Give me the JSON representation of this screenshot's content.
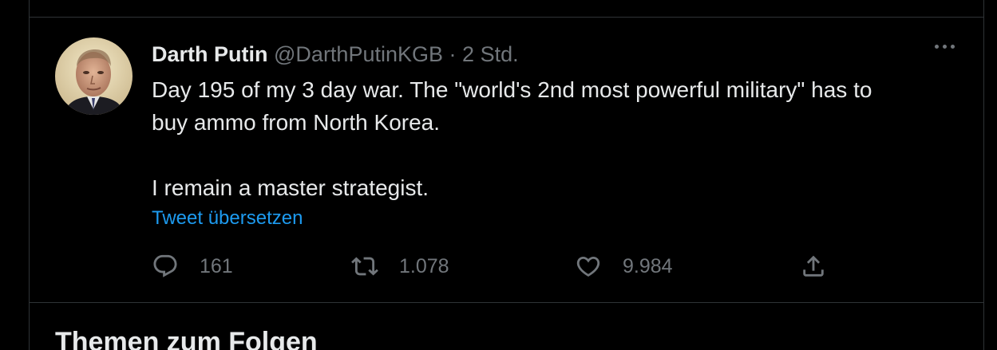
{
  "tweet": {
    "display_name": "Darth Putin",
    "handle": "@DarthPutinKGB",
    "separator": "·",
    "time": "2 Std.",
    "text_lines": [
      "Day 195 of my 3 day war. The \"world's 2nd most powerful military\" has to",
      "buy ammo from North Korea.",
      "I remain a master strategist."
    ],
    "translate_label": "Tweet übersetzen",
    "actions": {
      "reply": {
        "icon": "reply-icon",
        "count": "161"
      },
      "retweet": {
        "icon": "retweet-icon",
        "count": "1.078"
      },
      "like": {
        "icon": "heart-icon",
        "count": "9.984"
      },
      "share": {
        "icon": "share-icon"
      }
    },
    "more_icon": "more-dots-icon",
    "avatar_icon": "avatar-photo"
  },
  "section": {
    "title": "Themen zum Folgen"
  },
  "colors": {
    "background": "#000000",
    "text": "#e7e9ea",
    "secondary": "#71767b",
    "link": "#1d9bf0",
    "divider": "#2f3336"
  }
}
